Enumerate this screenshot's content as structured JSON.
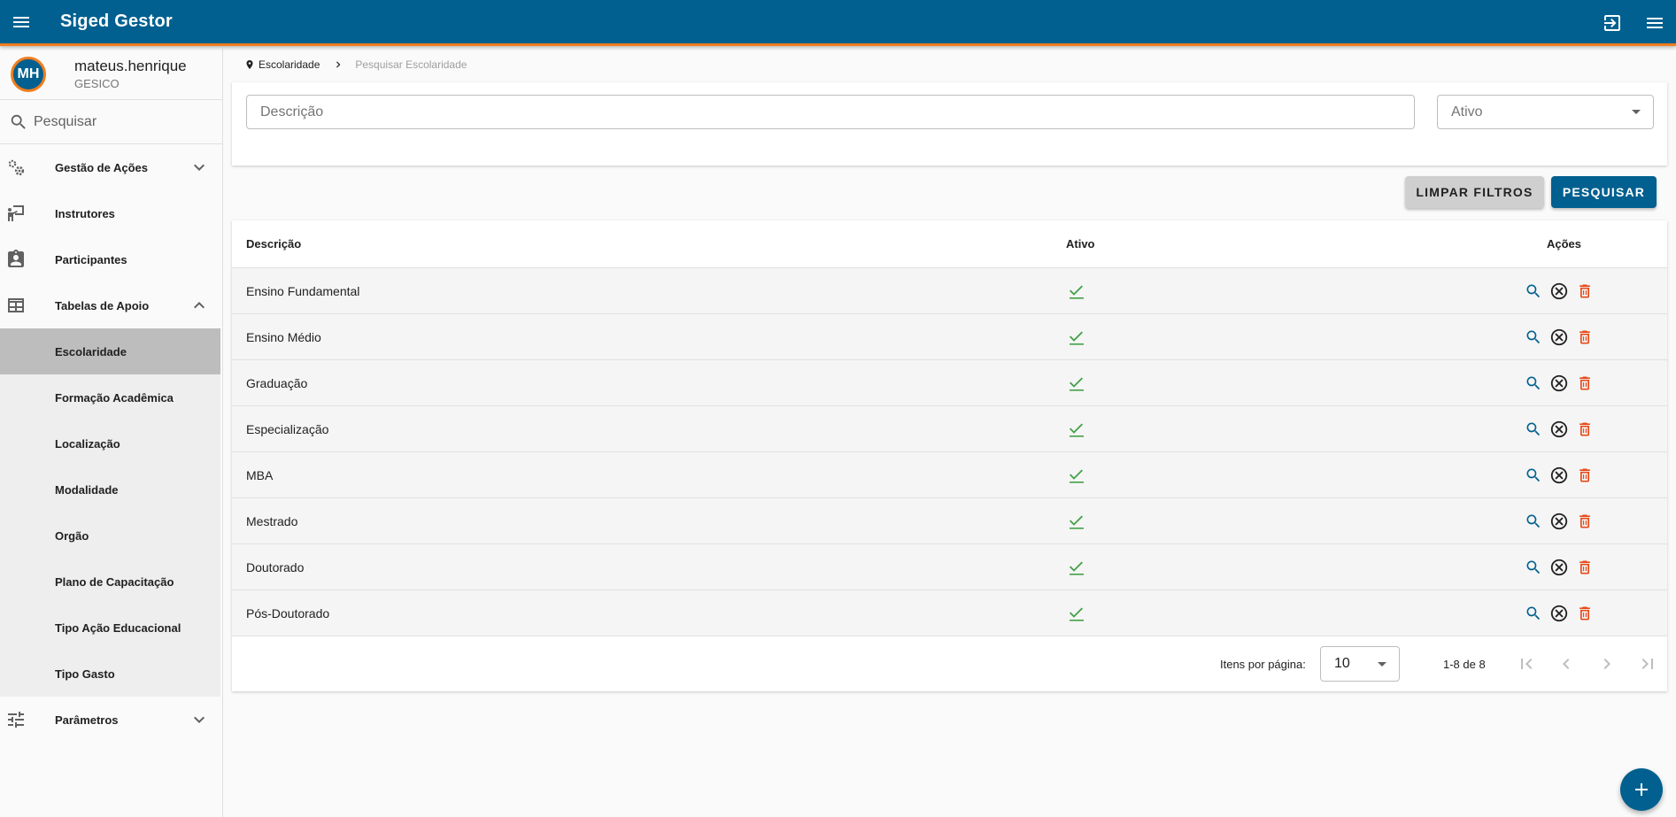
{
  "app": {
    "title": "Siged Gestor"
  },
  "user": {
    "initials": "MH",
    "name": "mateus.henrique",
    "org": "GESICO"
  },
  "sidebar": {
    "search_placeholder": "Pesquisar",
    "items": [
      {
        "label": "Gestão de Ações",
        "icon": "gears-icon",
        "expanded": false
      },
      {
        "label": "Instrutores",
        "icon": "instructor-icon"
      },
      {
        "label": "Participantes",
        "icon": "badge-icon"
      },
      {
        "label": "Tabelas de Apoio",
        "icon": "table-icon",
        "expanded": true
      },
      {
        "label": "Parâmetros",
        "icon": "sliders-icon",
        "expanded": false
      }
    ],
    "subitems": [
      {
        "label": "Escolaridade",
        "active": true
      },
      {
        "label": "Formação Acadêmica"
      },
      {
        "label": "Localização"
      },
      {
        "label": "Modalidade"
      },
      {
        "label": "Orgão"
      },
      {
        "label": "Plano de Capacitação"
      },
      {
        "label": "Tipo Ação Educacional"
      },
      {
        "label": "Tipo Gasto"
      }
    ]
  },
  "breadcrumb": {
    "current": "Escolaridade",
    "page": "Pesquisar Escolaridade"
  },
  "filters": {
    "description_placeholder": "Descrição",
    "status_placeholder": "Ativo",
    "clear_label": "LIMPAR FILTROS",
    "search_label": "PESQUISAR"
  },
  "table": {
    "headers": {
      "description": "Descrição",
      "active": "Ativo",
      "actions": "Ações"
    },
    "rows": [
      {
        "description": "Ensino Fundamental",
        "active": true
      },
      {
        "description": "Ensino Médio",
        "active": true
      },
      {
        "description": "Graduação",
        "active": true
      },
      {
        "description": "Especialização",
        "active": true
      },
      {
        "description": "MBA",
        "active": true
      },
      {
        "description": "Mestrado",
        "active": true
      },
      {
        "description": "Doutorado",
        "active": true
      },
      {
        "description": "Pós-Doutorado",
        "active": true
      }
    ]
  },
  "paginator": {
    "per_page_label": "Itens por página:",
    "per_page_value": "10",
    "range_label": "1-8 de 8"
  },
  "colors": {
    "primary": "#01608f",
    "accent": "#f07d1d",
    "check": "#43a047",
    "delete": "#e64a19"
  }
}
